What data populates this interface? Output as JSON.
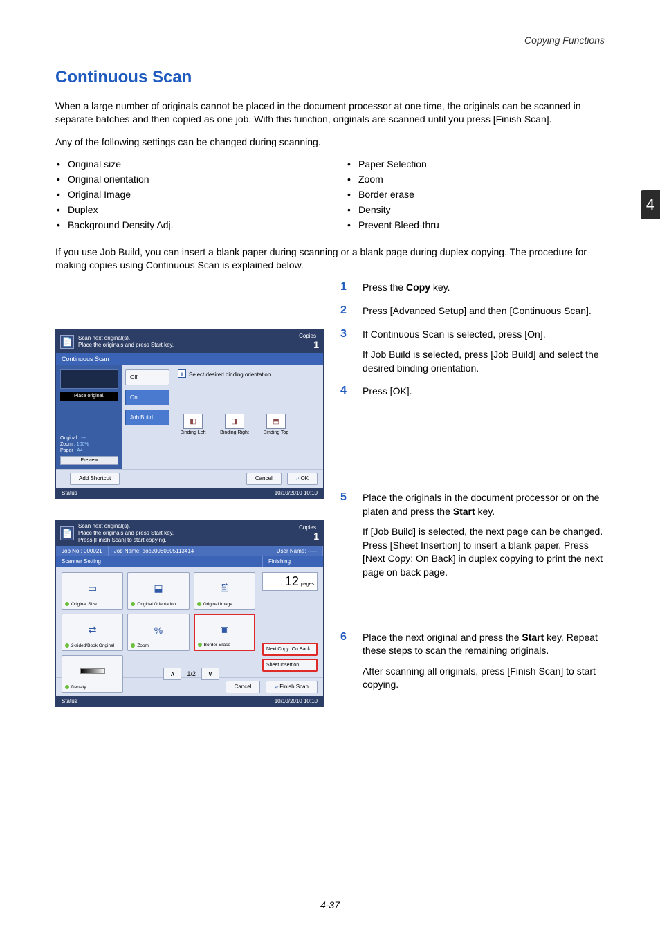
{
  "running_head": "Copying Functions",
  "chapter_tab": "4",
  "section_title": "Continuous Scan",
  "intro_p1": "When a large number of originals cannot be placed in the document processor at one time, the originals can be scanned in separate batches and then copied as one job. With this function, originals are scanned until you press [Finish Scan].",
  "intro_p2": "Any of the following settings can be changed during scanning.",
  "settings_left": [
    "Original size",
    "Original orientation",
    "Original Image",
    "Duplex",
    "Background Density Adj."
  ],
  "settings_right": [
    "Paper Selection",
    "Zoom",
    "Border erase",
    "Density",
    "Prevent Bleed-thru"
  ],
  "intro_p3": "If you use Job Build, you can insert a blank paper during scanning or a blank page during duplex copying. The procedure for making copies using Continuous Scan is explained below.",
  "steps": {
    "s1": {
      "n": "1",
      "p1a": "Press the ",
      "p1b": "Copy",
      "p1c": " key."
    },
    "s2": {
      "n": "2",
      "p1": "Press [Advanced Setup] and then [Continuous Scan]."
    },
    "s3": {
      "n": "3",
      "p1": "If Continuous Scan is selected, press [On].",
      "p2": "If Job Build is selected, press [Job Build] and select the desired binding orientation."
    },
    "s4": {
      "n": "4",
      "p1": "Press [OK]."
    },
    "s5": {
      "n": "5",
      "p1a": "Place the originals in the document processor or on the platen and press the ",
      "p1b": "Start",
      "p1c": " key.",
      "p2": "If [Job Build] is selected, the next page can be changed. Press [Sheet Insertion] to insert a blank paper. Press [Next Copy: On Back] in duplex copying to print the next page on back page."
    },
    "s6": {
      "n": "6",
      "p1a": "Place the next original and press the ",
      "p1b": "Start",
      "p1c": " key. Repeat these steps to scan the remaining originals.",
      "p2": "After scanning all originals, press [Finish Scan] to start copying."
    }
  },
  "page_num": "4-37",
  "panel1": {
    "header_l1": "Scan next original(s).",
    "header_l2": "Place the originals and press Start key.",
    "copies_label": "Copies",
    "copies_value": "1",
    "tab": "Continuous Scan",
    "place_original": "Place original.",
    "btn_off": "Off",
    "btn_on": "On",
    "btn_jobbuild": "Job Build",
    "hint": "Select desired binding orientation.",
    "info_original_l": "Original",
    "info_original_v": "---",
    "info_zoom_l": "Zoom",
    "info_zoom_v": "100%",
    "info_paper_l": "Paper",
    "info_paper_v": "A4",
    "preview": "Preview",
    "bind_left": "Binding Left",
    "bind_right": "Binding Right",
    "bind_top": "Binding Top",
    "add_shortcut": "Add Shortcut",
    "cancel": "Cancel",
    "ok": "OK",
    "status": "Status",
    "datetime": "10/10/2010   10:10"
  },
  "panel2": {
    "header_l1": "Scan next original(s).",
    "header_l2": "Place the originals and press Start key.",
    "header_l3": "Press [Finish Scan] to start copying.",
    "copies_label": "Copies",
    "copies_value": "1",
    "job_no": "Job No.: 000021",
    "job_name": "Job Name: doc20080505113414",
    "user_name": "User Name: -----",
    "scanner_setting": "Scanner Setting",
    "finishing": "Finishing",
    "pages_value": "12",
    "pages_label": "pages",
    "btn_orig_size": "Original Size",
    "btn_orig_orient": "Original Orientation",
    "btn_orig_image": "Original Image",
    "btn_2sided": "2-sided/Book Original",
    "btn_zoom": "Zoom",
    "btn_border": "Border Erase",
    "btn_density": "Density",
    "nav_page": "1/2",
    "next_copy": "Next Copy: On Back",
    "sheet_ins": "Sheet Insertion",
    "cancel": "Cancel",
    "finish": "Finish Scan",
    "status": "Status",
    "datetime": "10/10/2010   10:10"
  }
}
